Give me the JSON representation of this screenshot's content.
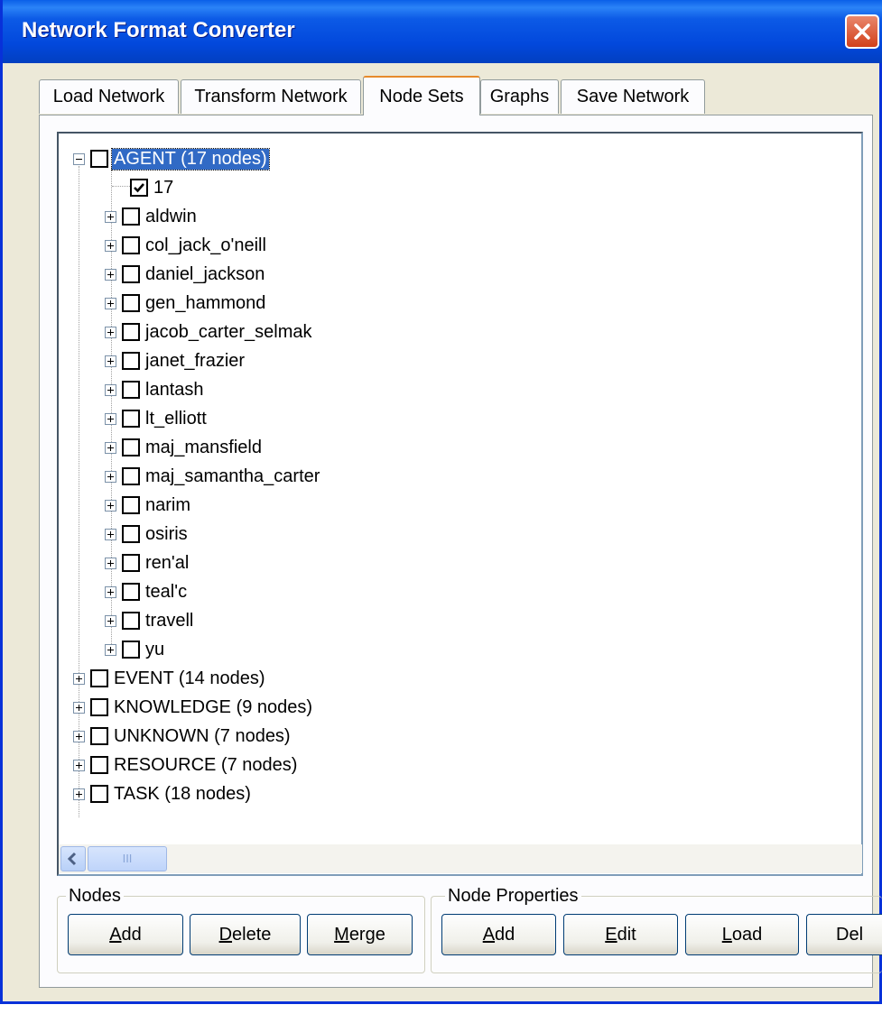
{
  "window": {
    "title": "Network Format Converter"
  },
  "tabs": [
    {
      "label": "Load Network",
      "active": false
    },
    {
      "label": "Transform Network",
      "active": false
    },
    {
      "label": "Node Sets",
      "active": true
    },
    {
      "label": "Graphs",
      "active": false
    },
    {
      "label": "Save Network",
      "active": false
    }
  ],
  "tree": {
    "root_agent": {
      "label": "AGENT (17 nodes)",
      "expanded": true,
      "selected": true,
      "checked": false
    },
    "agent_children": [
      {
        "label": "17",
        "checked": true,
        "expandable": false
      },
      {
        "label": "aldwin",
        "checked": false,
        "expandable": true
      },
      {
        "label": "col_jack_o'neill",
        "checked": false,
        "expandable": true
      },
      {
        "label": "daniel_jackson",
        "checked": false,
        "expandable": true
      },
      {
        "label": "gen_hammond",
        "checked": false,
        "expandable": true
      },
      {
        "label": "jacob_carter_selmak",
        "checked": false,
        "expandable": true
      },
      {
        "label": "janet_frazier",
        "checked": false,
        "expandable": true
      },
      {
        "label": "lantash",
        "checked": false,
        "expandable": true
      },
      {
        "label": "lt_elliott",
        "checked": false,
        "expandable": true
      },
      {
        "label": "maj_mansfield",
        "checked": false,
        "expandable": true
      },
      {
        "label": "maj_samantha_carter",
        "checked": false,
        "expandable": true
      },
      {
        "label": "narim",
        "checked": false,
        "expandable": true
      },
      {
        "label": "osiris",
        "checked": false,
        "expandable": true
      },
      {
        "label": "ren'al",
        "checked": false,
        "expandable": true
      },
      {
        "label": "teal'c",
        "checked": false,
        "expandable": true
      },
      {
        "label": "travell",
        "checked": false,
        "expandable": true
      },
      {
        "label": "yu",
        "checked": false,
        "expandable": true
      }
    ],
    "other_roots": [
      {
        "label": "EVENT (14 nodes)"
      },
      {
        "label": "KNOWLEDGE (9 nodes)"
      },
      {
        "label": "UNKNOWN (7 nodes)"
      },
      {
        "label": "RESOURCE (7 nodes)"
      },
      {
        "label": "TASK (18 nodes)"
      }
    ]
  },
  "scrollbar": {
    "thumb_grip": "III"
  },
  "nodes_group": {
    "title": "Nodes",
    "buttons": [
      {
        "label": "Add",
        "mnemonic": "A",
        "rest": "dd"
      },
      {
        "label": "Delete",
        "mnemonic": "D",
        "rest": "elete"
      },
      {
        "label": "Merge",
        "mnemonic": "M",
        "rest": "erge"
      }
    ]
  },
  "node_properties_group": {
    "title": "Node Properties",
    "buttons": [
      {
        "label": "Add",
        "mnemonic": "A",
        "rest": "dd"
      },
      {
        "label": "Edit",
        "mnemonic": "E",
        "rest": "dit"
      },
      {
        "label": "Load",
        "mnemonic": "L",
        "rest": "oad"
      },
      {
        "label": "Del",
        "mnemonic": "",
        "rest": "Del"
      }
    ]
  },
  "colors": {
    "titlebar": "#0248dc",
    "selection": "#316ac5",
    "window_bg": "#ece9d8"
  },
  "icons": {
    "close": "close-icon",
    "check": "checkmark-icon",
    "scroll_left": "scroll-left-arrow-icon"
  }
}
